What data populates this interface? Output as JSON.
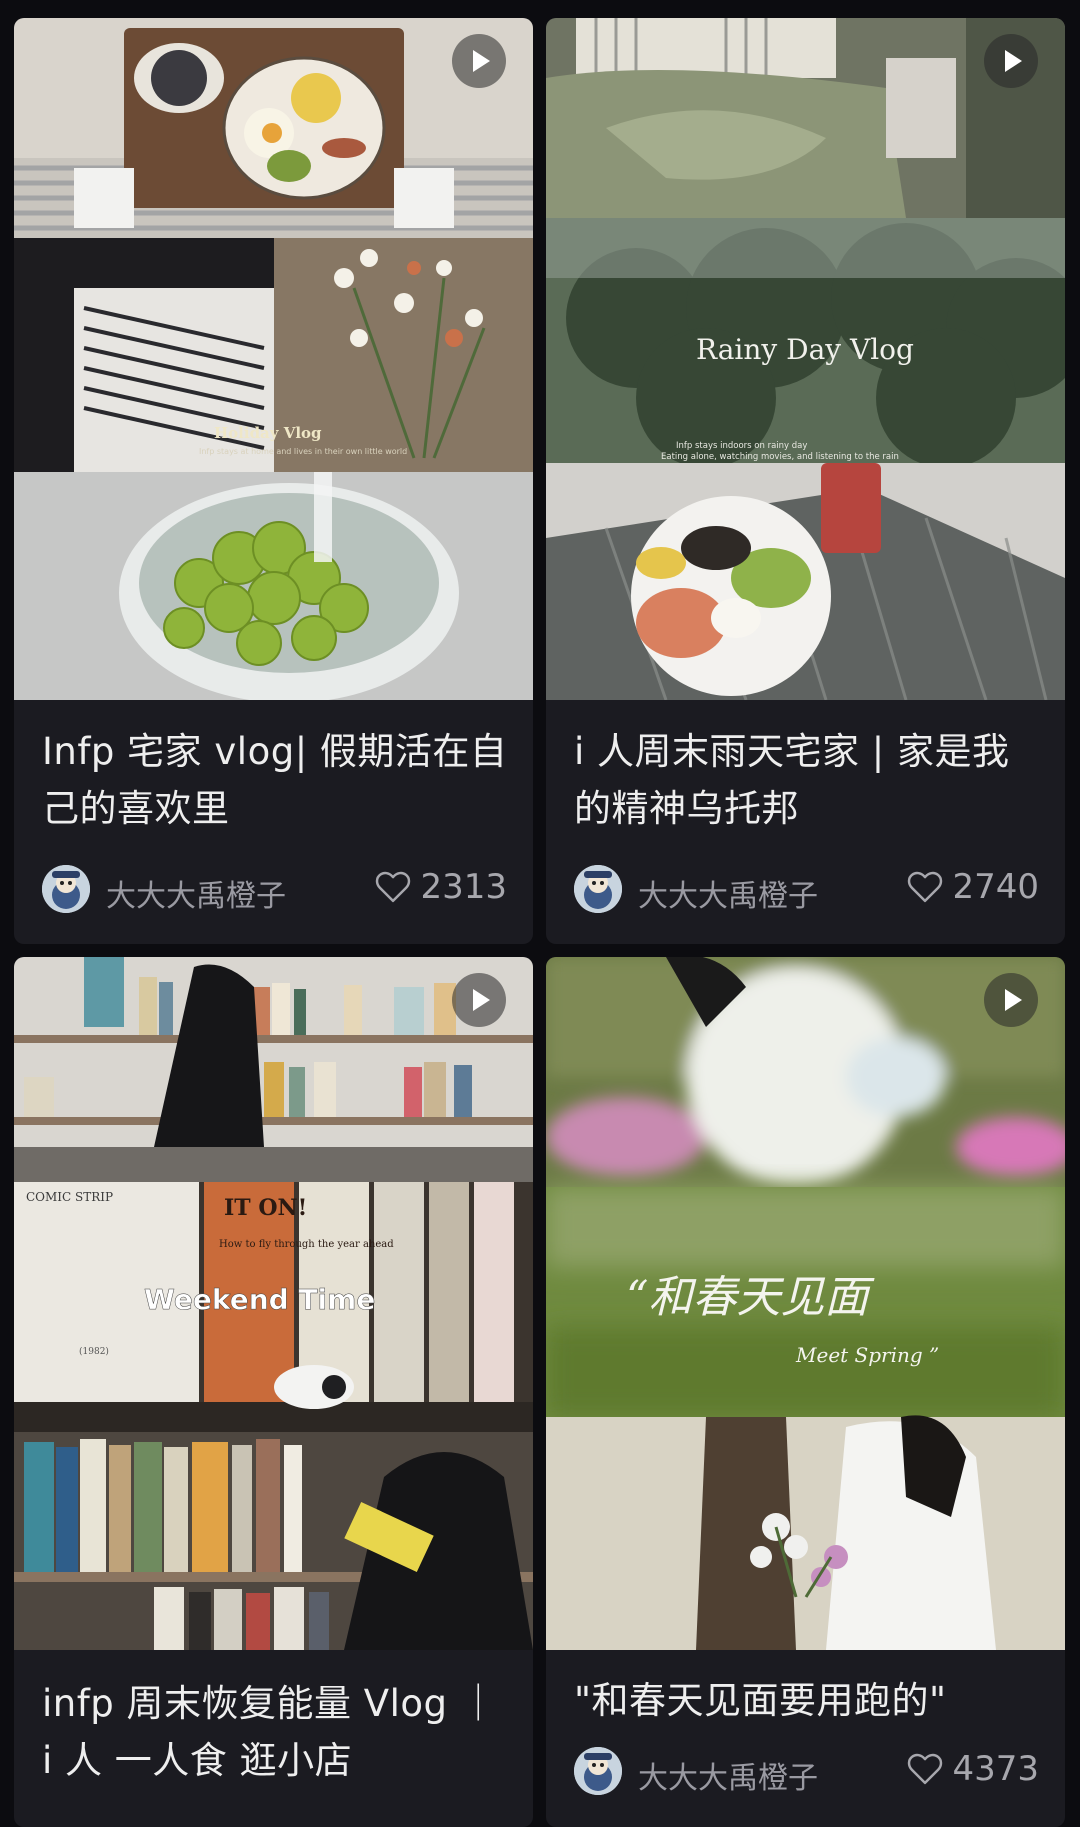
{
  "cards": [
    {
      "title": "Infp 宅家 vlog| 假期活在自己的喜欢里",
      "author": "大大大禹橙子",
      "likes": "2313",
      "overlay": "Holiday Vlog",
      "overlay_sub": "Infp stays at home and lives in their own little world"
    },
    {
      "title": "i 人周末雨天宅家 | 家是我的精神乌托邦",
      "author": "大大大禹橙子",
      "likes": "2740",
      "overlay": "Rainy Day Vlog",
      "overlay_sub": "Infp stays indoors on rainy day  Eating alone, watching movies, and listening to the rain"
    },
    {
      "title": "infp 周末恢复能量 Vlog ｜ i 人 一人食 逛小店",
      "overlay": "Weekend Time",
      "book_top": "COMIC STRIP",
      "book_mid": "IT ON!",
      "book_sub": "How to fly through the year ahead",
      "book_year": "(1982)"
    },
    {
      "title": "\"和春天见面要用跑的\"",
      "author": "大大大禹橙子",
      "likes": "4373",
      "overlay": "“和春天见面",
      "overlay_sub": "Meet Spring ”"
    }
  ]
}
